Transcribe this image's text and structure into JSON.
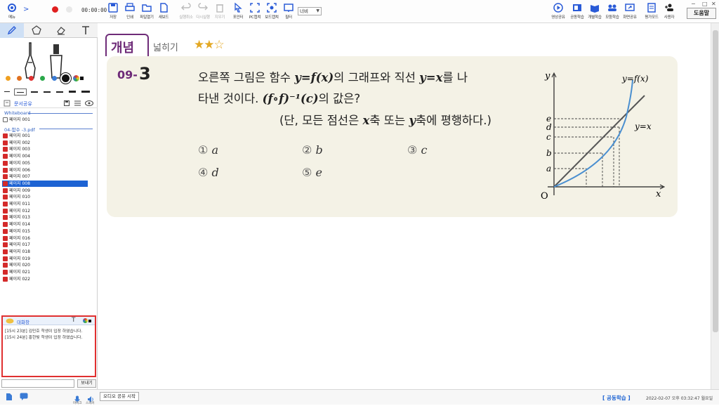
{
  "toolbar": {
    "menu_label": "메뉴",
    "timer": "00:00:00",
    "buttons": [
      {
        "label": "저장"
      },
      {
        "label": "인쇄"
      },
      {
        "label": "파일열기"
      },
      {
        "label": "새보드"
      },
      {
        "label": "실행취소"
      },
      {
        "label": "다시실행"
      },
      {
        "label": "지우기"
      },
      {
        "label": "포인터"
      },
      {
        "label": "PC캡쳐"
      },
      {
        "label": "보드캡쳐"
      },
      {
        "label": "필터"
      }
    ],
    "zoom": "너비",
    "right_buttons": [
      {
        "label": "영상공유"
      },
      {
        "label": "공동학습"
      },
      {
        "label": "개별학습"
      },
      {
        "label": "모둠학습"
      },
      {
        "label": "화면공유"
      },
      {
        "label": "평가모드"
      },
      {
        "label": "사용자"
      }
    ],
    "help_label": "도움말",
    "colors": {
      "accent": "#1d63d3",
      "record": "#e02020"
    }
  },
  "left_panel": {
    "tool_tabs": [
      "pen-icon",
      "shape-icon",
      "eraser-icon",
      "text-icon"
    ],
    "swatch_colors": [
      "#f0a020",
      "#e07020",
      "#e03030",
      "#2aa84a",
      "#3a7bd5",
      "#111111"
    ],
    "doc_share_title": "문서공유",
    "whiteboard_label": "Whiteboard",
    "whiteboard_page": "페이지 001",
    "pdf_label": "04-함수 -3.pdf",
    "pages": [
      "페이지 001",
      "페이지 002",
      "페이지 003",
      "페이지 004",
      "페이지 005",
      "페이지 006",
      "페이지 007",
      "페이지 008",
      "페이지 009",
      "페이지 010",
      "페이지 011",
      "페이지 012",
      "페이지 013",
      "페이지 014",
      "페이지 015",
      "페이지 016",
      "페이지 017",
      "페이지 018",
      "페이지 019",
      "페이지 020",
      "페이지 021",
      "페이지 022"
    ],
    "selected_page": "페이지 008",
    "chat": {
      "title": "대화창",
      "messages": [
        "[15시 23분] 김민호 학생이 입장 하였습니다.",
        "[15시 24분] 홍한빛 학생이 입장 하였습니다."
      ],
      "send_label": "보내기",
      "input_value": ""
    }
  },
  "bottom": {
    "mic_label": "마이크",
    "speaker_label": "스피커",
    "audio_share_label": "오디오 공유 시작",
    "mode": "[ 공동학습 ]",
    "datetime": "2022-02-07 오후 03:32:47 월요일"
  },
  "document": {
    "tag": "개념",
    "subtitle": "넓히기",
    "stars": "★★☆",
    "problem_prefix": "09-",
    "problem_num": "3",
    "q_line1_a": "오른쪽 그림은 함수 ",
    "q_line1_m1": "y=f(x)",
    "q_line1_b": "의 그래프와 직선 ",
    "q_line1_m2": "y=x",
    "q_line1_c": "를 나",
    "q_line2_a": "타낸 것이다. ",
    "q_line2_m": "(f∘f)⁻¹(c)",
    "q_line2_b": "의 값은?",
    "q_line3_a": "(단, 모든 점선은 ",
    "q_line3_m1": "x",
    "q_line3_b": "축 또는 ",
    "q_line3_m2": "y",
    "q_line3_c": "축에 평행하다.)",
    "choices": [
      {
        "num": "①",
        "val": "a"
      },
      {
        "num": "②",
        "val": "b"
      },
      {
        "num": "③",
        "val": "c"
      },
      {
        "num": "④",
        "val": "d"
      },
      {
        "num": "⑤",
        "val": "e"
      }
    ],
    "graph": {
      "y_axis": "y",
      "x_axis": "x",
      "origin": "O",
      "curve_label": "y=f(x)",
      "line_label": "y=x",
      "y_ticks": [
        "e",
        "d",
        "c",
        "b",
        "a"
      ],
      "curve_color": "#4a8fd0",
      "line_color": "#555555"
    }
  }
}
